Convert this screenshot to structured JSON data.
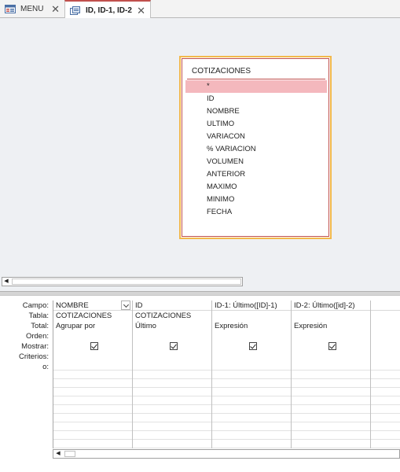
{
  "tabs": [
    {
      "label": "MENU",
      "icon": "form-icon"
    },
    {
      "label": "ID, ID-1, ID-2",
      "icon": "query-icon",
      "active": true
    }
  ],
  "table_box": {
    "title": "COTIZACIONES",
    "fields": [
      "*",
      "ID",
      "NOMBRE",
      "ULTIMO",
      "VARIACON",
      "% VARIACION",
      "VOLUMEN",
      "ANTERIOR",
      "MAXIMO",
      "MINIMO",
      "FECHA"
    ]
  },
  "grid": {
    "row_labels": [
      "Campo:",
      "Tabla:",
      "Total:",
      "Orden:",
      "Mostrar:",
      "Criterios:",
      "o:"
    ],
    "columns": [
      {
        "campo": "NOMBRE",
        "tabla": "COTIZACIONES",
        "total": "Agrupar por",
        "orden": "",
        "mostrar": true
      },
      {
        "campo": "ID",
        "tabla": "COTIZACIONES",
        "total": "Último",
        "orden": "",
        "mostrar": true
      },
      {
        "campo": "ID-1: Último([ID]-1)",
        "tabla": "",
        "total": "Expresión",
        "orden": "",
        "mostrar": true
      },
      {
        "campo": "ID-2: Último([id]-2)",
        "tabla": "",
        "total": "Expresión",
        "orden": "",
        "mostrar": true
      }
    ]
  },
  "colors": {
    "accent": "#c0504d",
    "highlight": "#f4b8bd",
    "table_border": "#f2b84b"
  }
}
